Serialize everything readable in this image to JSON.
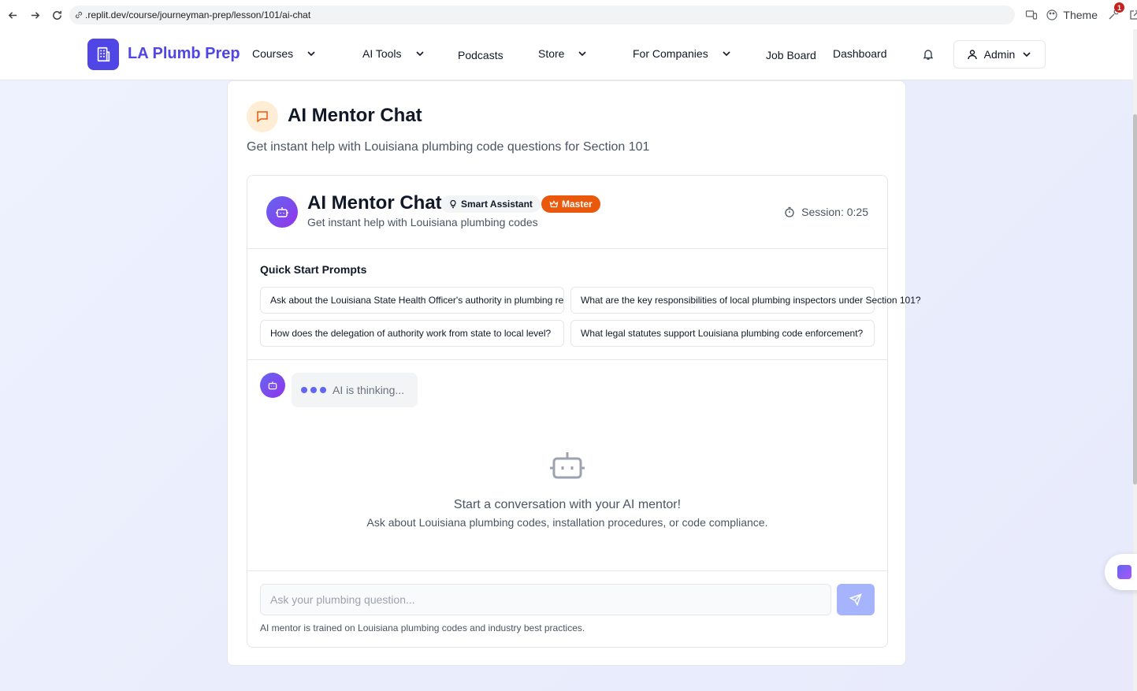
{
  "browser": {
    "url_prefix": ".replit.dev",
    "url_path": "/course/journeyman-prep/lesson/101/ai-chat",
    "theme_label": "Theme",
    "extension_badge": "1"
  },
  "header": {
    "logo_text": "LA Plumb Prep",
    "nav": [
      {
        "label": "Courses"
      },
      {
        "label": "AI Tools"
      },
      {
        "label": "Podcasts"
      },
      {
        "label": "Store"
      },
      {
        "label": "For Companies"
      },
      {
        "label": "Job Board"
      },
      {
        "label": "Dashboard"
      }
    ],
    "user_label": "Admin"
  },
  "page": {
    "title": "AI Mentor Chat",
    "subtitle": "Get instant help with Louisiana plumbing code questions for Section 101"
  },
  "chat": {
    "title": "AI Mentor Chat",
    "badge_smart": "Smart Assistant",
    "badge_master": "Master",
    "subtitle": "Get instant help with Louisiana plumbing codes",
    "session_label": "Session: 0:25",
    "quick_start_title": "Quick Start Prompts",
    "prompts": [
      "Ask about the Louisiana State Health Officer's authority in plumbing regulation",
      "What are the key responsibilities of local plumbing inspectors under Section 101?",
      "How does the delegation of authority work from state to local level?",
      "What legal statutes support Louisiana plumbing code enforcement?"
    ],
    "thinking_text": "AI is thinking...",
    "empty_title": "Start a conversation with your AI mentor!",
    "empty_subtitle": "Ask about Louisiana plumbing codes, installation procedures, or code compliance.",
    "input_placeholder": "Ask your plumbing question...",
    "footnote": "AI mentor is trained on Louisiana plumbing codes and industry best practices."
  },
  "colors": {
    "brand": "#4f46e5",
    "master_badge": "#ea580c",
    "send_button": "#a5b4fc"
  }
}
